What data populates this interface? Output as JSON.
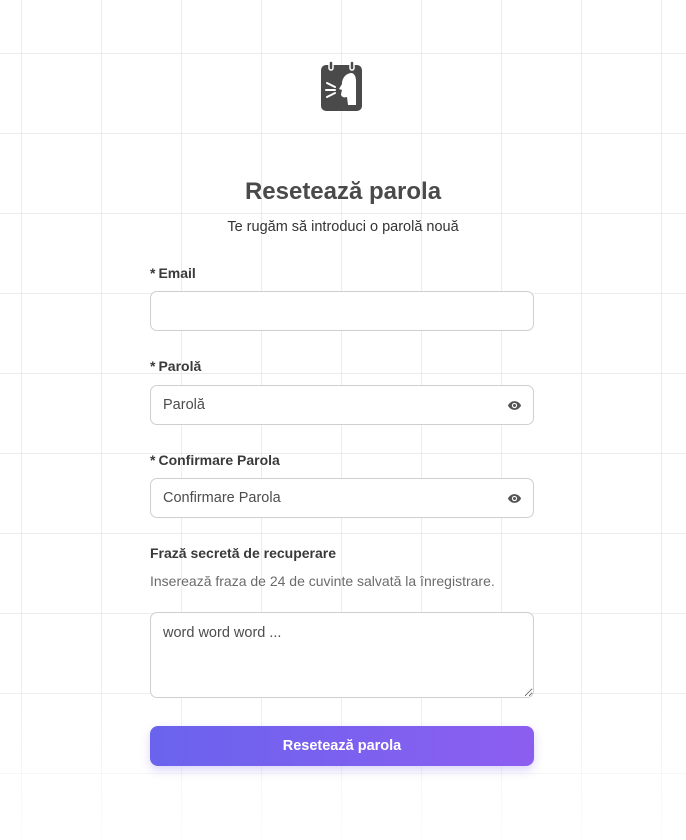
{
  "page": {
    "title": "Resetează parola",
    "subtitle": "Te rugăm să introduci o parolă nouă",
    "logo_icon": "app-logo-icon"
  },
  "form": {
    "required_marker": "*",
    "email": {
      "label": "Email",
      "value": "",
      "placeholder": ""
    },
    "password": {
      "label": "Parolă",
      "placeholder": "Parolă",
      "toggle_icon": "eye-icon"
    },
    "confirm_password": {
      "label": "Confirmare Parola",
      "placeholder": "Confirmare Parola",
      "toggle_icon": "eye-icon"
    },
    "recovery_phrase": {
      "label": "Frază secretă de recuperare",
      "help": "Inserează fraza de 24 de cuvinte salvată la înregistrare.",
      "placeholder": "word word word ..."
    },
    "submit_label": "Resetează parola"
  },
  "colors": {
    "button_gradient_start": "#6a63ee",
    "button_gradient_end": "#8c5ef0",
    "logo": "#4a4a4a"
  }
}
